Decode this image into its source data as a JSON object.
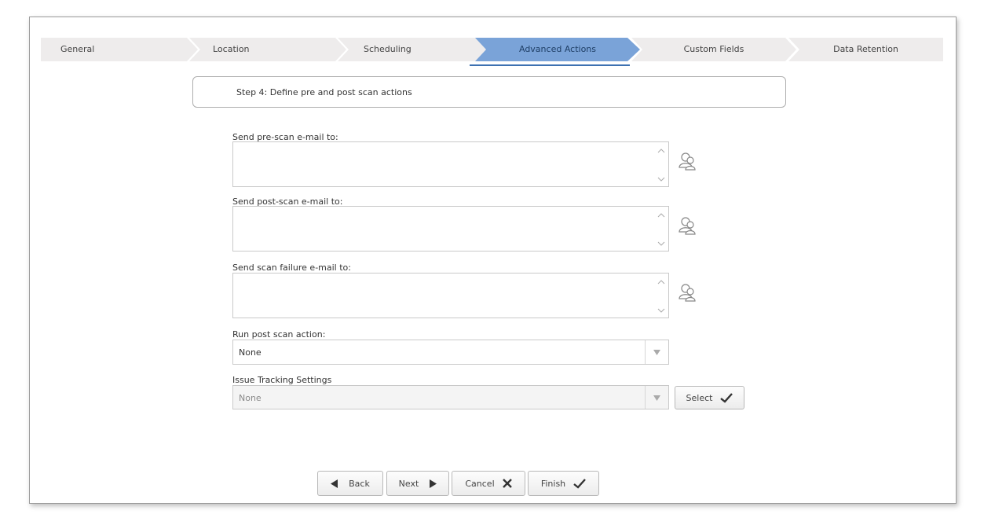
{
  "wizard": {
    "tabs": [
      {
        "label": "General",
        "active": false
      },
      {
        "label": "Location",
        "active": false
      },
      {
        "label": "Scheduling",
        "active": false
      },
      {
        "label": "Advanced Actions",
        "active": true
      },
      {
        "label": "Custom Fields",
        "active": false
      },
      {
        "label": "Data Retention",
        "active": false
      }
    ],
    "step_title": "Step 4: Define pre and post scan actions"
  },
  "form": {
    "pre_scan_label": "Send pre-scan e-mail to:",
    "pre_scan_value": "",
    "post_scan_label": "Send post-scan e-mail to:",
    "post_scan_value": "",
    "failure_label": "Send scan failure e-mail to:",
    "failure_value": "",
    "post_action_label": "Run post scan action:",
    "post_action_value": "None",
    "issue_tracking_label": "Issue Tracking Settings",
    "issue_tracking_value": "None",
    "select_button": "Select"
  },
  "footer": {
    "back": "Back",
    "next": "Next",
    "cancel": "Cancel",
    "finish": "Finish"
  },
  "icons": {
    "address_book": "address-book-icon",
    "dropdown": "triangle-down-icon",
    "checkmark": "checkmark-icon",
    "back": "triangle-left-icon",
    "next": "triangle-right-icon",
    "cancel": "x-icon"
  },
  "colors": {
    "active_tab": "#7aa3d8",
    "inactive_tab": "#eeecec",
    "active_underline": "#3d71b1"
  }
}
